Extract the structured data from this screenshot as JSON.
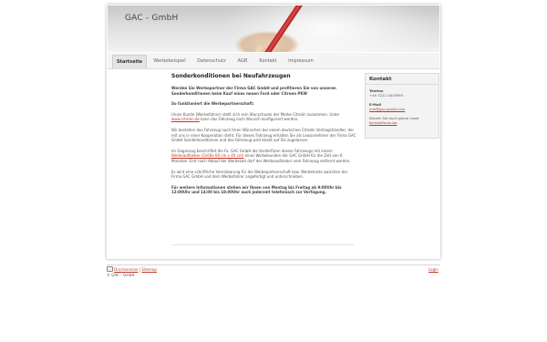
{
  "site": {
    "title": "GAC - GmbH"
  },
  "nav": {
    "tabs": [
      {
        "label": "Startseite",
        "active": true
      },
      {
        "label": "Werbebeispiel"
      },
      {
        "label": "Datenschutz"
      },
      {
        "label": "AGB"
      },
      {
        "label": "Kontakt"
      },
      {
        "label": "Impressum"
      }
    ]
  },
  "main": {
    "heading": "Sonderkonditionen bei Neufahrzeugen",
    "intro": "Werden Sie Werbepartner der Firma GAC GmbH und profitieren Sie von unseren Sonderkonditionen beim Kauf eines neuen Ford oder Citroen PKW",
    "subheading": "So funktioniert die Werbepartnerschaft:",
    "p1_a": "Unser Kunde (Werbefahrer) stellt sich sein Wunschauto der Marke Citroën zusammen. Unter ",
    "p1_link": "www.citroen.de",
    "p1_b": " kann das Fahrzeug nach Wunsch konfiguriert werden.",
    "p2": "Wir bestellen das Fahrzeug nach Ihren Wünschen bei einem deutschen Citroën Vertragshändler, der mit uns in einer Kooperation steht. Für dieses Fahrzeug erhalten Sie als Leasinnehmer der Firma GAC GmbH Sonderkonditionen und das Fahrzeug wird direkt auf Sie zugelassen.",
    "p3_a": "Im Gegenzug beschriftet die Fa. GAC GmbH die Vorderfüren dieses Fahrzeugs mit einem ",
    "p3_link": "Werbeaufkleber (Größe 60 cm x 40 cm)",
    "p3_b": " eines Werbekunden der GAC GmbH für die Zeit von 6 Monaten. Erst nach Ablauf der Werbezeit darf der Werbeaufkleber vom Fahrzeug entfernt werden.",
    "p4": "Es wird eine schriftliche Vereinbarung für die Werbepartnerschaft bzw. Werbeleiste zwischen der Firma GAC GmbH und dem Werbefahrer angefertigt und unterschrieben.",
    "p5": "Für weitere Informationen stehen wir Ihnen von Montag bis Freitag ab 9:00Uhr bis 12:00Uhr und 14:00 bis 18:00Uhr auch jederzeit telefonisch zur Verfügung."
  },
  "sidebar": {
    "title": "Kontakt",
    "phone_label": "Telefon",
    "phone": "+49 7222 2819595",
    "email_label": "E-Mail",
    "email": "info@gac-gmbh.com",
    "note_a": "Nutzen Sie auch gerne unser ",
    "note_link": "Kontaktformular",
    "note_b": "."
  },
  "footer": {
    "print": "Druckversion",
    "sep": "|",
    "sitemap": "Sitemap",
    "copyright": "© GAC - GmbH",
    "login": "Login"
  },
  "colors": {
    "link": "#c0392b",
    "accent_pen": "#c62828"
  }
}
